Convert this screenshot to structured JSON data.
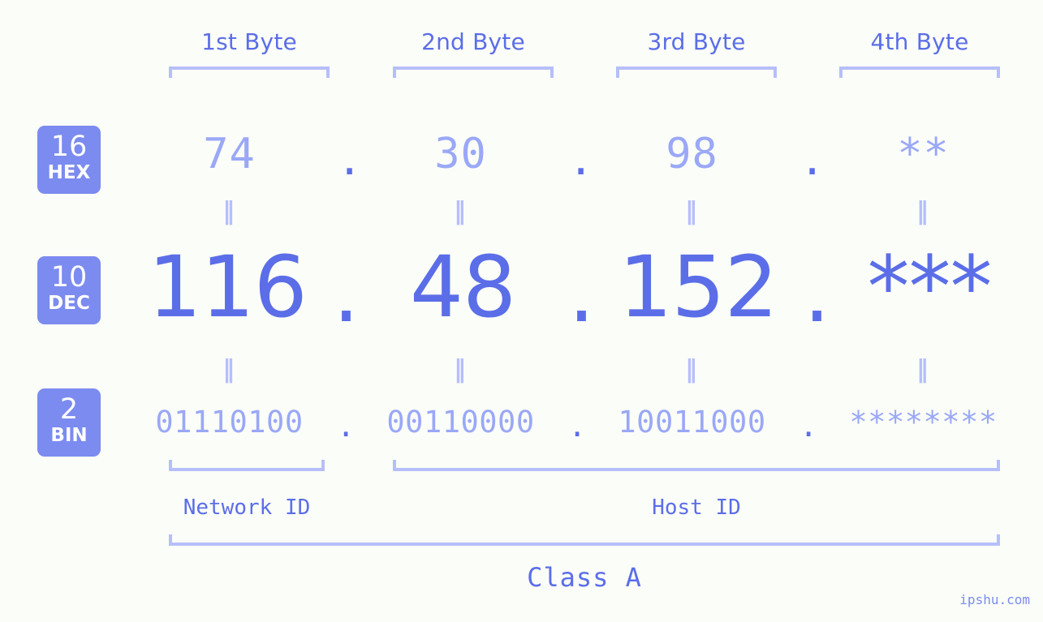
{
  "colors": {
    "background": "#fbfdf8",
    "accent_strong": "#5b6ee8",
    "accent_light": "#9aa8f7",
    "bracket": "#b6bffb",
    "badge_fill": "#7b8bef",
    "badge_text": "#ffffff"
  },
  "byte_headers": [
    {
      "label": "1st Byte"
    },
    {
      "label": "2nd Byte"
    },
    {
      "label": "3rd Byte"
    },
    {
      "label": "4th Byte"
    }
  ],
  "radix_badges": [
    {
      "radix": "16",
      "system": "HEX"
    },
    {
      "radix": "10",
      "system": "DEC"
    },
    {
      "radix": "2",
      "system": "BIN"
    }
  ],
  "separator": {
    "mark": "‖"
  },
  "dot": {
    "glyph": "."
  },
  "rows": {
    "hex": {
      "system": "HEX",
      "radix": "16",
      "bytes": [
        "74",
        "30",
        "98",
        "**"
      ]
    },
    "dec": {
      "system": "DEC",
      "radix": "10",
      "bytes": [
        "116",
        "48",
        "152",
        "***"
      ]
    },
    "bin": {
      "system": "BIN",
      "radix": "2",
      "bytes": [
        "01110100",
        "00110000",
        "10011000",
        "********"
      ]
    }
  },
  "id_sections": [
    {
      "label": "Network ID"
    },
    {
      "label": "Host ID"
    }
  ],
  "class": {
    "label": "Class A"
  },
  "watermark": {
    "text": "ipshu.com"
  }
}
